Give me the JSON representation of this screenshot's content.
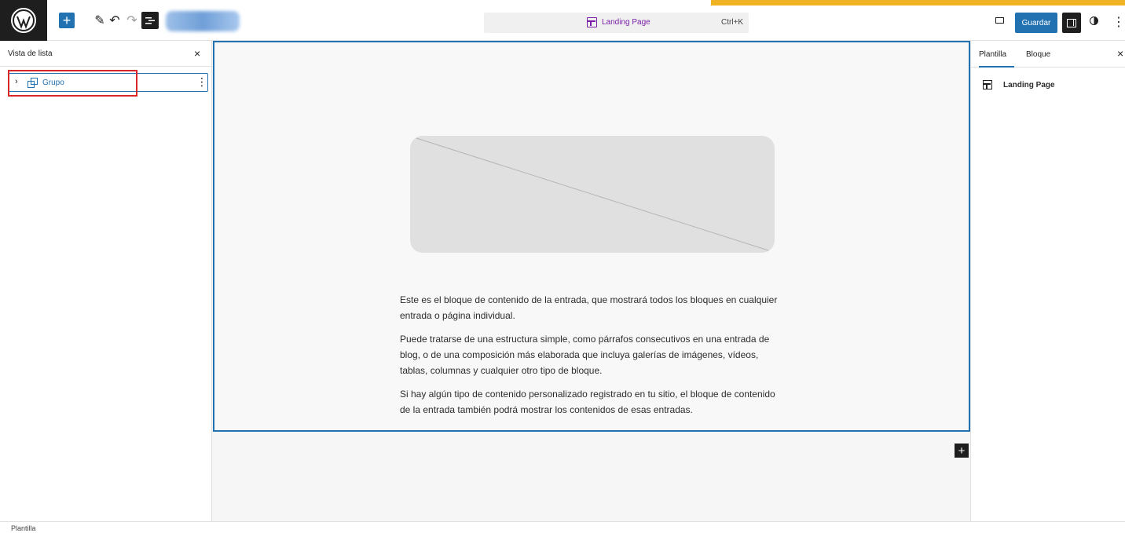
{
  "topbar": {
    "command_title": "Landing Page",
    "command_shortcut": "Ctrl+K",
    "save_label": "Guardar"
  },
  "left_panel": {
    "title": "Vista de lista",
    "items": [
      {
        "label": "Grupo"
      }
    ]
  },
  "right_panel": {
    "tabs": [
      {
        "label": "Plantilla"
      },
      {
        "label": "Bloque"
      }
    ],
    "template_name": "Landing Page"
  },
  "content": {
    "paragraphs": [
      "Este es el bloque de contenido de la entrada, que mostrará todos los bloques en cualquier entrada o página individual.",
      "Puede tratarse de una estructura simple, como párrafos consecutivos en una entrada de blog, o de una composición más elaborada que incluya galerías de imágenes, vídeos, tablas, columnas y cualquier otro tipo de bloque.",
      "Si hay algún tipo de contenido personalizado registrado en tu sitio, el bloque de contenido de la entrada también podrá mostrar los contenidos de esas entradas."
    ]
  },
  "footer": {
    "breadcrumb": "Plantilla"
  },
  "colors": {
    "accent": "#2271b1",
    "highlight": "#d92626",
    "command_text": "#7a1ea8",
    "top_strip": "#f0b323"
  }
}
